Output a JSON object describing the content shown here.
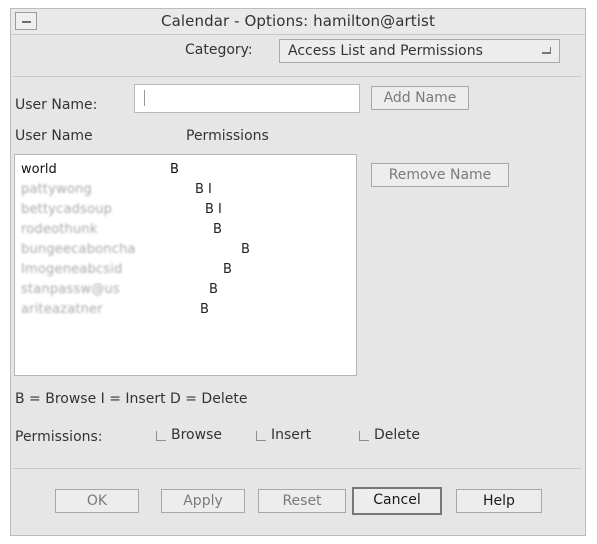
{
  "window": {
    "title": "Calendar - Options: hamilton@artist"
  },
  "category": {
    "label": "Category:",
    "value": "Access List and Permissions"
  },
  "user_field": {
    "label": "User Name:",
    "value": "",
    "add_button": "Add Name"
  },
  "access_list": {
    "header_user": "User Name",
    "header_permissions": "Permissions",
    "remove_button": "Remove Name",
    "rows": [
      {
        "name": "world",
        "permissions": "B"
      },
      {
        "name": "pattywong",
        "permissions": "B I"
      },
      {
        "name": "bettycadsoup",
        "permissions": "B I"
      },
      {
        "name": "rodeothunk",
        "permissions": "B"
      },
      {
        "name": "bungeecaboncha",
        "permissions": "B"
      },
      {
        "name": "Imogeneabcsid",
        "permissions": "B"
      },
      {
        "name": "stanpassw@us",
        "permissions": "B"
      },
      {
        "name": "ariteazatner",
        "permissions": "B"
      }
    ]
  },
  "legend": "B = Browse I = Insert D = Delete",
  "permissions": {
    "label": "Permissions:",
    "options": [
      "Browse",
      "Insert",
      "Delete"
    ]
  },
  "footer": {
    "ok": "OK",
    "apply": "Apply",
    "reset": "Reset",
    "cancel": "Cancel",
    "help": "Help"
  },
  "colors": {
    "window_bg": "#e6e6e6",
    "list_bg": "#ffffff",
    "disabled_text": "#7a7a7a"
  }
}
